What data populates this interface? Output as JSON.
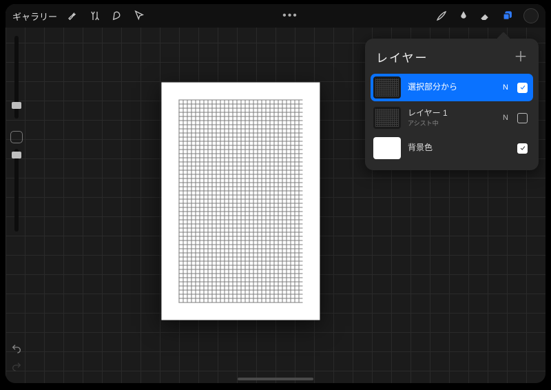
{
  "topbar": {
    "gallery_label": "ギャラリー",
    "overflow": "•••"
  },
  "layers_panel": {
    "title": "レイヤー",
    "add_label": "＋",
    "blend_code": "N",
    "layers": [
      {
        "name": "選択部分から",
        "sub": "",
        "thumb": "pattern",
        "selected": true,
        "blend": "N",
        "visible": true
      },
      {
        "name": "レイヤー 1",
        "sub": "アシスト中",
        "thumb": "pattern",
        "selected": false,
        "blend": "N",
        "visible": false
      },
      {
        "name": "背景色",
        "sub": "",
        "thumb": "white",
        "selected": false,
        "blend": "",
        "visible": true
      }
    ]
  }
}
